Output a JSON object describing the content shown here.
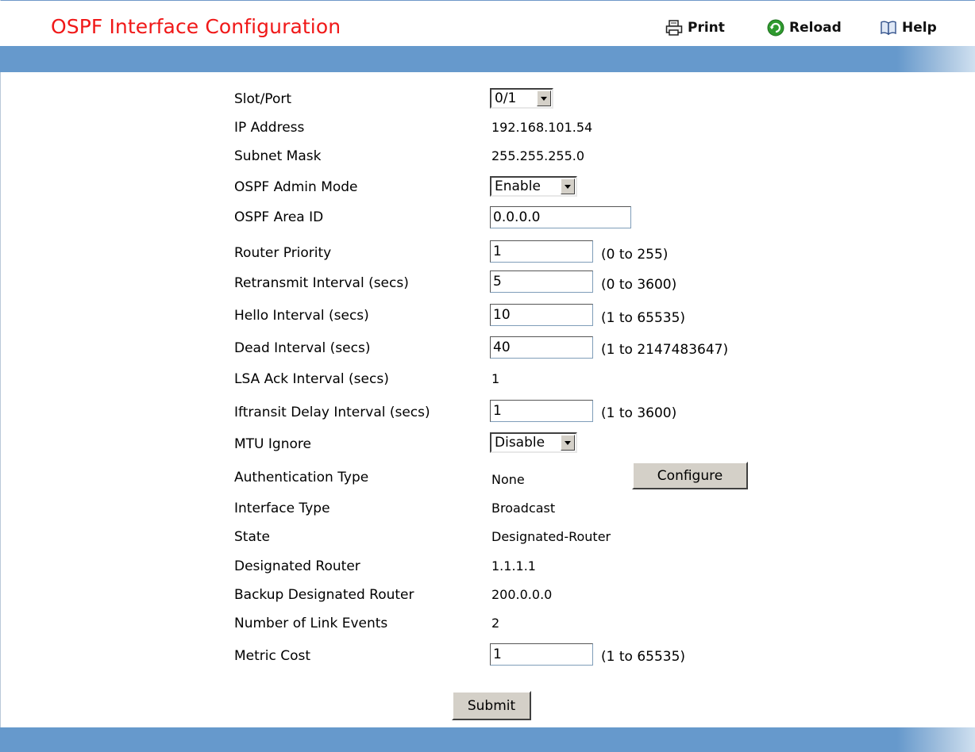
{
  "page": {
    "title": "OSPF Interface Configuration"
  },
  "toolbar": {
    "print_label": "Print",
    "reload_label": "Reload",
    "help_label": "Help"
  },
  "form": {
    "slot_port": {
      "label": "Slot/Port",
      "value": "0/1"
    },
    "ip_address": {
      "label": "IP Address",
      "value": "192.168.101.54"
    },
    "subnet_mask": {
      "label": "Subnet Mask",
      "value": "255.255.255.0"
    },
    "admin_mode": {
      "label": "OSPF Admin Mode",
      "value": "Enable"
    },
    "area_id": {
      "label": "OSPF Area ID",
      "value": "0.0.0.0"
    },
    "router_priority": {
      "label": "Router Priority",
      "value": "1",
      "range": "(0 to 255)"
    },
    "retransmit_interval": {
      "label": "Retransmit Interval (secs)",
      "value": "5",
      "range": "(0 to 3600)"
    },
    "hello_interval": {
      "label": "Hello Interval (secs)",
      "value": "10",
      "range": "(1 to 65535)"
    },
    "dead_interval": {
      "label": "Dead Interval (secs)",
      "value": "40",
      "range": "(1 to 2147483647)"
    },
    "lsa_ack_interval": {
      "label": "LSA Ack Interval (secs)",
      "value": "1"
    },
    "iftransit_delay": {
      "label": "Iftransit Delay Interval (secs)",
      "value": "1",
      "range": "(1 to 3600)"
    },
    "mtu_ignore": {
      "label": "MTU Ignore",
      "value": "Disable"
    },
    "auth_type": {
      "label": "Authentication Type",
      "value": "None",
      "button": "Configure"
    },
    "interface_type": {
      "label": "Interface Type",
      "value": "Broadcast"
    },
    "state": {
      "label": "State",
      "value": "Designated-Router"
    },
    "designated_router": {
      "label": "Designated Router",
      "value": "1.1.1.1"
    },
    "backup_designated_router": {
      "label": "Backup Designated Router",
      "value": "200.0.0.0"
    },
    "link_events": {
      "label": "Number of Link Events",
      "value": "2"
    },
    "metric_cost": {
      "label": "Metric Cost",
      "value": "1",
      "range": "(1 to 65535)"
    },
    "submit_label": "Submit"
  },
  "colors": {
    "title": "#f01818",
    "bar": "#6699cc",
    "button_face": "#d4d0c8"
  }
}
